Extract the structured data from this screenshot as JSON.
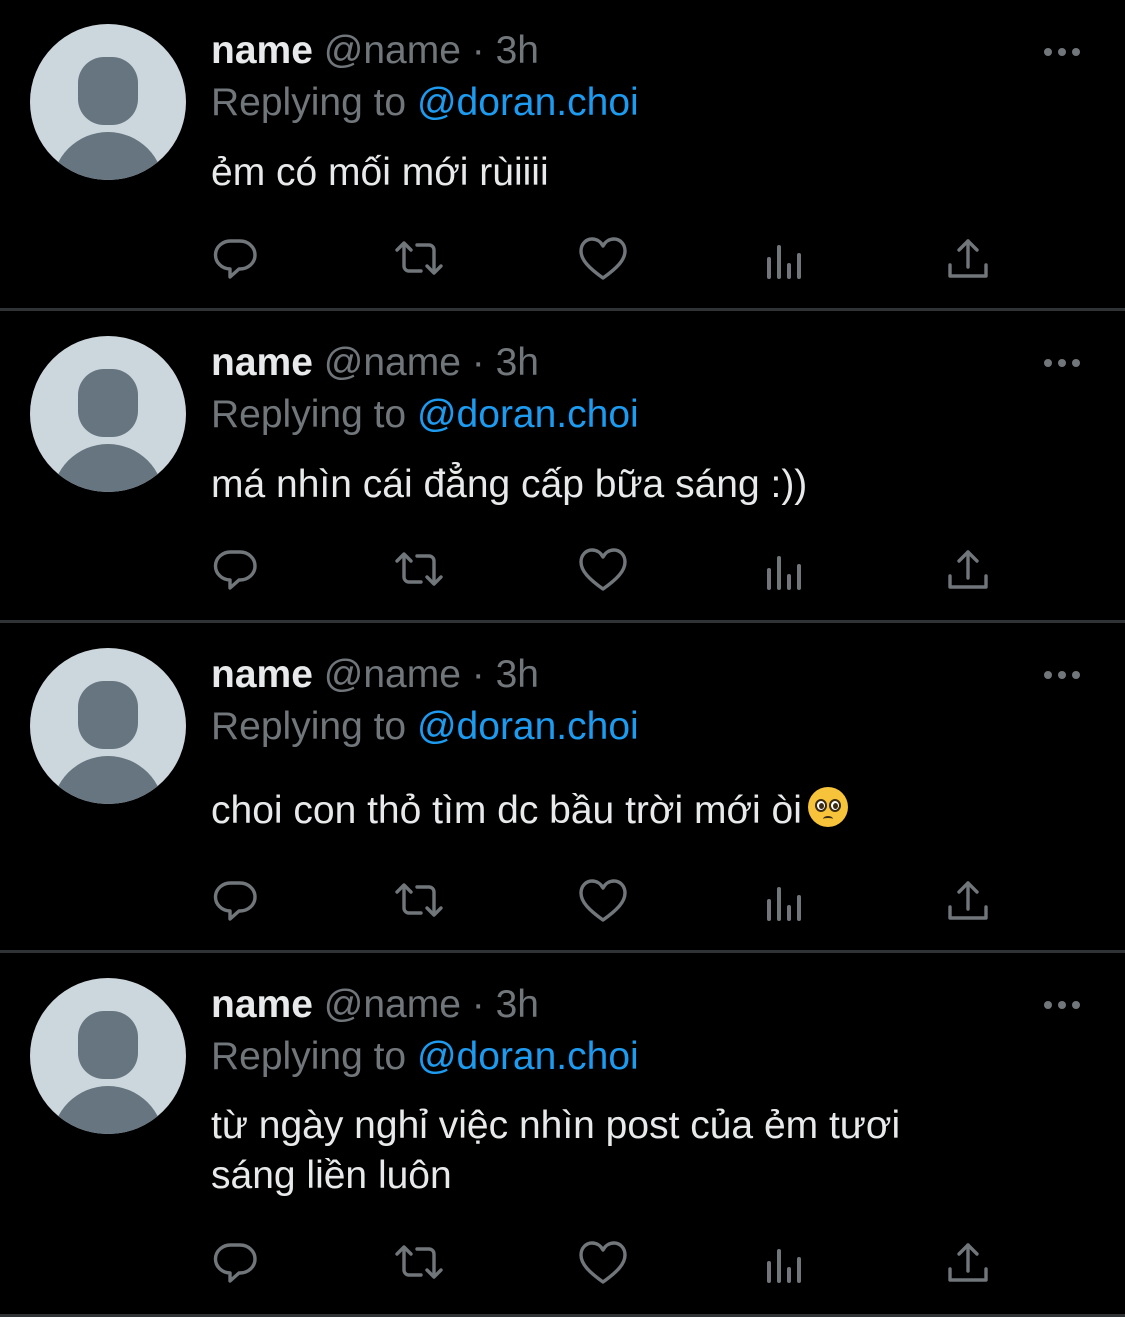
{
  "colors": {
    "background": "#000000",
    "text": "#e7e9ea",
    "muted": "#71767b",
    "accent": "#1d9bf0",
    "divider": "#2f3336",
    "avatar_bg": "#ccd6dd",
    "avatar_fg": "#66757f"
  },
  "tweets": [
    {
      "display_name": "name",
      "handle": "@name",
      "separator": "·",
      "time": "3h",
      "replying_prefix": "Replying to",
      "replying_to": "@doran.choi",
      "text_lines": [
        "ẻm có mối mới rùiiii"
      ],
      "emoji": null,
      "actions": [
        "reply-icon",
        "retweet-icon",
        "like-icon",
        "analytics-icon",
        "share-icon"
      ]
    },
    {
      "display_name": "name",
      "handle": "@name",
      "separator": "·",
      "time": "3h",
      "replying_prefix": "Replying to",
      "replying_to": "@doran.choi",
      "text_lines": [
        "má nhìn cái đẳng cấp bữa sáng :))"
      ],
      "emoji": null,
      "actions": [
        "reply-icon",
        "retweet-icon",
        "like-icon",
        "analytics-icon",
        "share-icon"
      ]
    },
    {
      "display_name": "name",
      "handle": "@name",
      "separator": "·",
      "time": "3h",
      "replying_prefix": "Replying to",
      "replying_to": "@doran.choi",
      "text_lines": [
        "choi con thỏ tìm dc bầu trời mới òi"
      ],
      "emoji": "pleading-face-emoji",
      "actions": [
        "reply-icon",
        "retweet-icon",
        "like-icon",
        "analytics-icon",
        "share-icon"
      ]
    },
    {
      "display_name": "name",
      "handle": "@name",
      "separator": "·",
      "time": "3h",
      "replying_prefix": "Replying to",
      "replying_to": "@doran.choi",
      "text_lines": [
        "từ ngày nghỉ việc nhìn post của ẻm tươi",
        "sáng liền luôn"
      ],
      "emoji": null,
      "actions": [
        "reply-icon",
        "retweet-icon",
        "like-icon",
        "analytics-icon",
        "share-icon"
      ]
    }
  ]
}
